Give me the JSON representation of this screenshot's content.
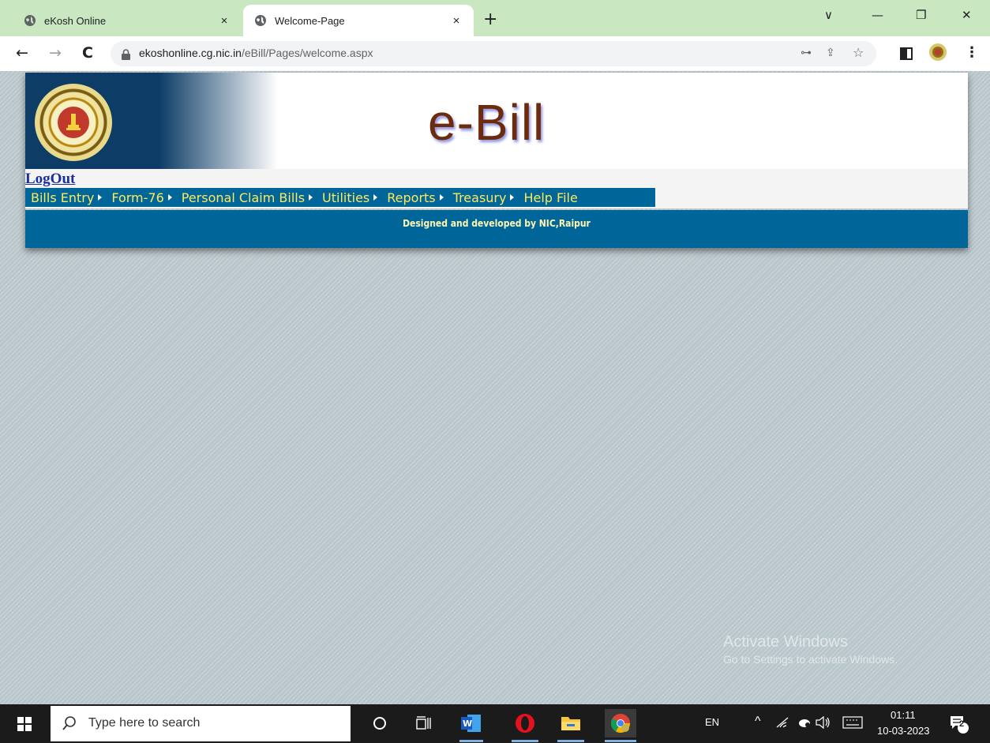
{
  "browser": {
    "tabs": [
      {
        "title": "eKosh Online",
        "close": "×"
      },
      {
        "title": "Welcome-Page",
        "close": "×"
      }
    ],
    "new_tab": "+",
    "window_controls": {
      "dropdown": "∨",
      "minimize": "—",
      "restore": "❐",
      "close": "✕"
    },
    "url_domain": "ekoshonline.cg.nic.in",
    "url_path": "/eBill/Pages/welcome.aspx",
    "nav": {
      "back": "←",
      "forward": "→",
      "reload": "C"
    },
    "omnibox_icons": {
      "key": "⊶",
      "share": "⇪",
      "star": "☆"
    },
    "menu": "⋮"
  },
  "page": {
    "brand": "e-Bill",
    "logout": "LogOut",
    "menu": [
      {
        "label": "Bills Entry"
      },
      {
        "label": "Form-76"
      },
      {
        "label": "Personal Claim Bills"
      },
      {
        "label": "Utilities"
      },
      {
        "label": "Reports"
      },
      {
        "label": "Treasury"
      },
      {
        "label": "Help File"
      }
    ],
    "footer": "Designed and developed by NIC,Raipur",
    "colors": {
      "menu_bg": "#006699",
      "menu_text": "#ffe85a",
      "banner_dark": "#0d3d66",
      "brand_text": "#6b2b0c"
    }
  },
  "watermark": {
    "line1": "Activate Windows",
    "line2": "Go to Settings to activate Windows."
  },
  "taskbar": {
    "search_placeholder": "Type here to search",
    "language": "EN",
    "time": "01:11",
    "date": "10-03-2023",
    "notifications": "2"
  }
}
